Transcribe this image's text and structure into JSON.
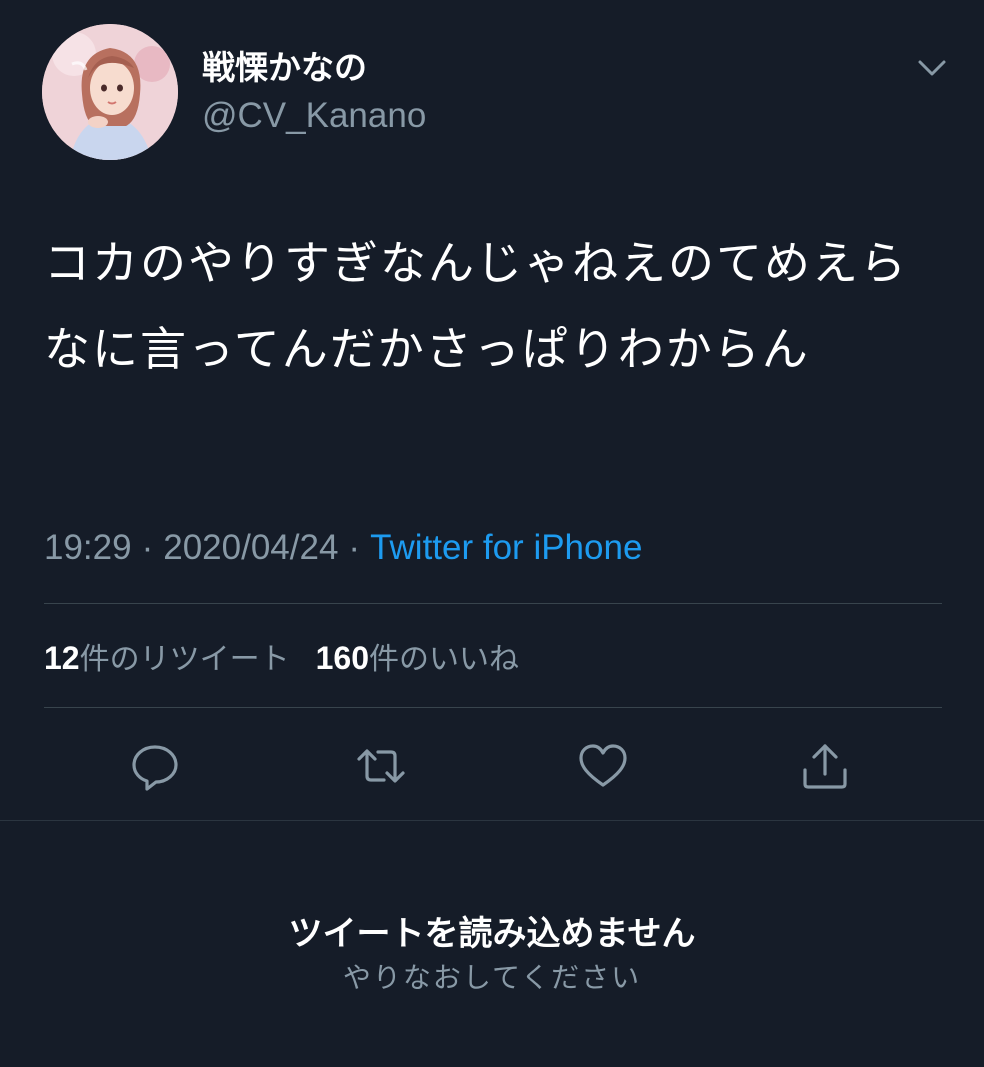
{
  "user": {
    "display_name": "戦慄かなの",
    "handle": "@CV_Kanano"
  },
  "tweet": {
    "text": "コカのやりすぎなんじゃねえのてめえらなに言ってんだかさっぱりわからん",
    "time": "19:29",
    "date": "2020/04/24",
    "separator": "·",
    "source": "Twitter for iPhone"
  },
  "stats": {
    "retweet_count": "12",
    "retweet_label": "件のリツイート",
    "like_count": "160",
    "like_label": "件のいいね"
  },
  "actions": {
    "icons": [
      "reply-icon",
      "retweet-icon",
      "like-icon",
      "share-icon"
    ]
  },
  "error": {
    "title": "ツイートを読み込めません",
    "subtitle": "やりなおしてください"
  },
  "colors": {
    "background": "#151c28",
    "muted": "#8899a6",
    "link": "#1d9bf0",
    "divider": "#38444d"
  }
}
